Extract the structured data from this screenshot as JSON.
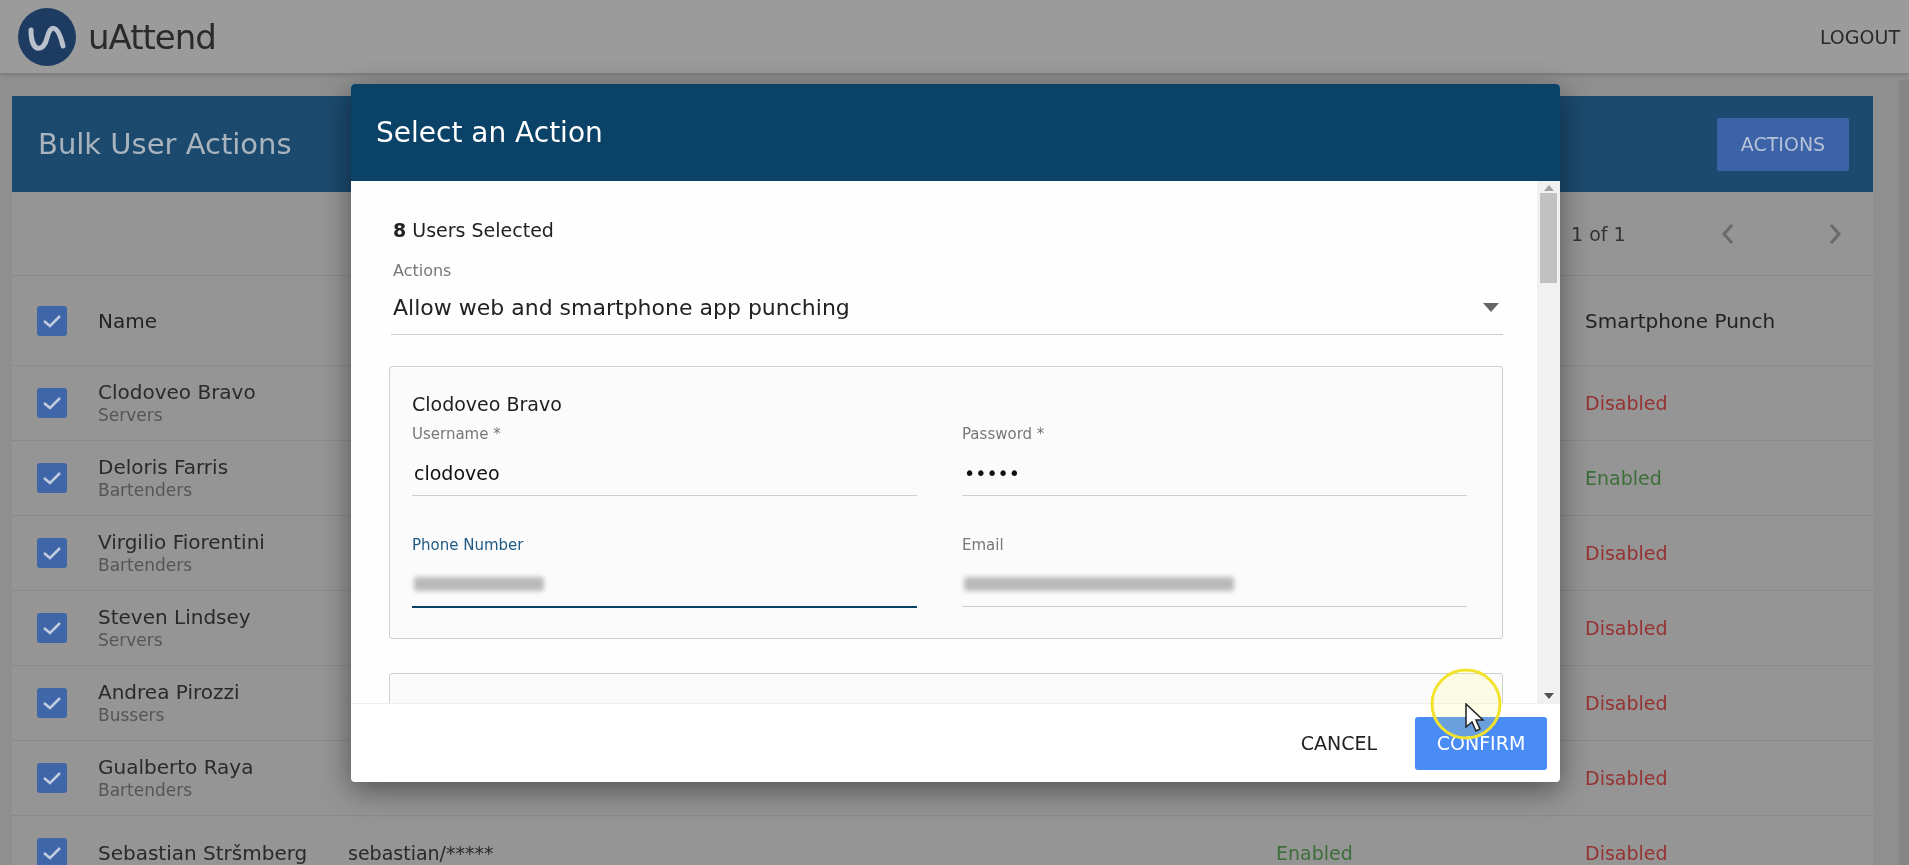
{
  "app": {
    "logo_text": "uAttend",
    "logout": "LOGOUT"
  },
  "panel": {
    "title": "Bulk User Actions",
    "actions_button": "ACTIONS",
    "pagination": "1 of 1"
  },
  "table": {
    "select_all_checked": true,
    "header": {
      "name": "Name",
      "smartphone_punch": "Smartphone Punch"
    },
    "rows": [
      {
        "checked": true,
        "name": "Clodoveo Bravo",
        "group": "Servers",
        "smartphone_punch": {
          "text": "Disabled",
          "enabled": false
        }
      },
      {
        "checked": true,
        "name": "Deloris Farris",
        "group": "Bartenders",
        "smartphone_punch": {
          "text": "Enabled",
          "enabled": true
        }
      },
      {
        "checked": true,
        "name": "Virgilio Fiorentini",
        "group": "Bartenders",
        "smartphone_punch": {
          "text": "Disabled",
          "enabled": false
        }
      },
      {
        "checked": true,
        "name": "Steven Lindsey",
        "group": "Servers",
        "smartphone_punch": {
          "text": "Disabled",
          "enabled": false
        }
      },
      {
        "checked": true,
        "name": "Andrea Pirozzi",
        "group": "Bussers",
        "smartphone_punch": {
          "text": "Disabled",
          "enabled": false
        }
      },
      {
        "checked": true,
        "name": "Gualberto Raya",
        "group": "Bartenders",
        "smartphone_punch": {
          "text": "Disabled",
          "enabled": false
        }
      },
      {
        "checked": true,
        "name": "Sebastian Stršmberg",
        "column_2": "sebastian/*****",
        "column_3": {
          "text": "Enabled",
          "enabled": true
        },
        "smartphone_punch": {
          "text": "Disabled",
          "enabled": false
        }
      }
    ]
  },
  "modal": {
    "title": "Select an Action",
    "selected": "**8** Users Selected",
    "actions_label": "Actions",
    "action_value": "Allow web and smartphone app punching",
    "cards": [
      {
        "kind": "user",
        "name": "Clodoveo Bravo",
        "fields": [
          {
            "kind": "text",
            "label": "Username *",
            "value": "clodoveo",
            "focused": false
          },
          {
            "kind": "text",
            "label": "Password *",
            "value": "•••••",
            "focused": false
          },
          {
            "kind": "blurred",
            "label": "Phone Number",
            "focused": true
          },
          {
            "kind": "blurred",
            "label": "Email",
            "focused": false
          }
        ]
      },
      {
        "kind": "clipped"
      }
    ],
    "cancel": "CANCEL",
    "confirm": "CONFIRM"
  }
}
